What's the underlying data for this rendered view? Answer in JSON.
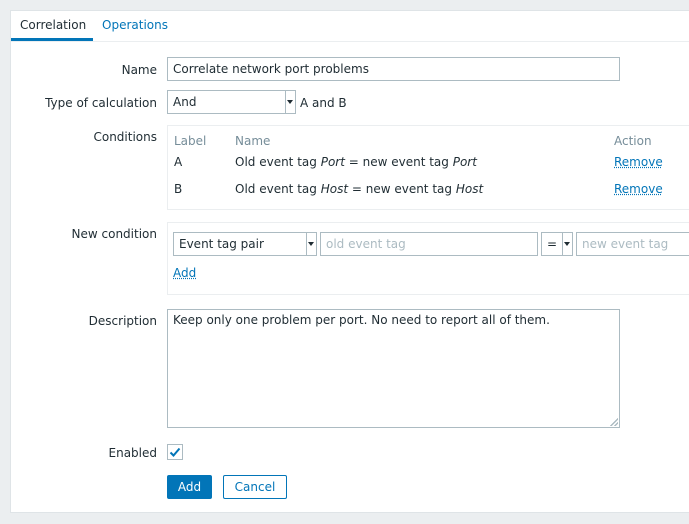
{
  "tabs": [
    {
      "label": "Correlation",
      "active": true
    },
    {
      "label": "Operations",
      "active": false
    }
  ],
  "form": {
    "name_label": "Name",
    "name_value": "Correlate network port problems",
    "calc_label": "Type of calculation",
    "calc_value": "And",
    "calc_formula": "A and B",
    "conditions_label": "Conditions",
    "conditions_headers": {
      "label": "Label",
      "name": "Name",
      "action": "Action"
    },
    "conditions": [
      {
        "label": "A",
        "prefix": "Old event tag ",
        "tag1": "Port",
        "mid": " = new event tag ",
        "tag2": "Port",
        "action": "Remove"
      },
      {
        "label": "B",
        "prefix": "Old event tag ",
        "tag1": "Host",
        "mid": " = new event tag ",
        "tag2": "Host",
        "action": "Remove"
      }
    ],
    "new_condition_label": "New condition",
    "new_condition_type": "Event tag pair",
    "old_tag_placeholder": "old event tag",
    "operator": "=",
    "new_tag_placeholder": "new event tag",
    "add_condition": "Add",
    "description_label": "Description",
    "description_value": "Keep only one problem per port. No need to report all of them.",
    "enabled_label": "Enabled",
    "enabled": true,
    "add_button": "Add",
    "cancel_button": "Cancel"
  },
  "colors": {
    "accent": "#0275b8",
    "background": "#ebeef0",
    "text": "#1f2c33",
    "muted": "#768d99"
  }
}
